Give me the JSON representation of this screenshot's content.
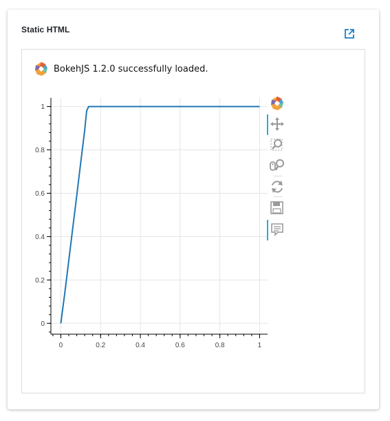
{
  "card": {
    "title": "Static HTML",
    "open_icon": "open-in-new-icon"
  },
  "output": {
    "status_text": "BokehJS 1.2.0 successfully loaded.",
    "status_icon": "bokeh-logo-icon"
  },
  "toolbar": {
    "items": [
      {
        "icon": "bokeh-logo-icon",
        "active": false
      },
      {
        "icon": "pan-icon",
        "active": true
      },
      {
        "icon": "box-zoom-icon",
        "active": false
      },
      {
        "icon": "wheel-zoom-icon",
        "active": false
      },
      {
        "icon": "reset-icon",
        "active": false
      },
      {
        "icon": "save-icon",
        "active": false
      },
      {
        "icon": "hover-icon",
        "active": true
      }
    ],
    "accent_color": "#26aae1"
  },
  "chart_data": {
    "type": "line",
    "title": "",
    "xlabel": "",
    "ylabel": "",
    "xlim": [
      -0.05,
      1.04
    ],
    "ylim": [
      -0.05,
      1.04
    ],
    "x_ticks": [
      "0",
      "0.2",
      "0.4",
      "0.6",
      "0.8",
      "1"
    ],
    "y_ticks": [
      "0",
      "0.2",
      "0.4",
      "0.6",
      "0.8",
      "1"
    ],
    "grid": true,
    "legend": "none",
    "series": [
      {
        "color": "#1f77b4",
        "x": [
          0.0,
          0.02,
          0.04,
          0.06,
          0.08,
          0.1,
          0.12,
          0.13,
          0.14,
          0.2,
          0.4,
          0.6,
          0.8,
          1.0
        ],
        "y": [
          0.0,
          0.14,
          0.29,
          0.44,
          0.59,
          0.74,
          0.89,
          0.98,
          1.0,
          1.0,
          1.0,
          1.0,
          1.0,
          1.0
        ]
      }
    ]
  }
}
